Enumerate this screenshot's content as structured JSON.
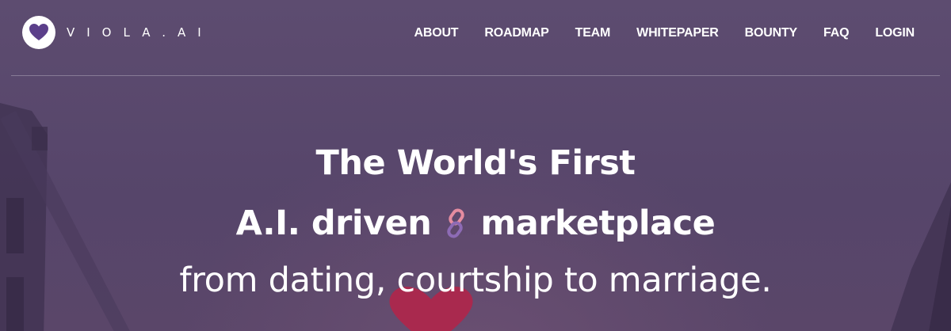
{
  "brand": {
    "name": "VIOLA.AI",
    "logo_icon": "heart-icon",
    "accent_color": "#5b3f8a"
  },
  "nav": {
    "items": [
      {
        "label": "ABOUT"
      },
      {
        "label": "ROADMAP"
      },
      {
        "label": "TEAM"
      },
      {
        "label": "WHITEPAPER"
      },
      {
        "label": "BOUNTY"
      },
      {
        "label": "FAQ"
      },
      {
        "label": "LOGIN"
      }
    ]
  },
  "hero": {
    "line1": "The World's First",
    "line2_before": "A.I. driven",
    "line2_icon": "chain-link-icon",
    "line2_after": "marketplace",
    "line3": "from dating, courtship to marriage."
  },
  "colors": {
    "background": "#58476c",
    "text": "#ffffff"
  }
}
